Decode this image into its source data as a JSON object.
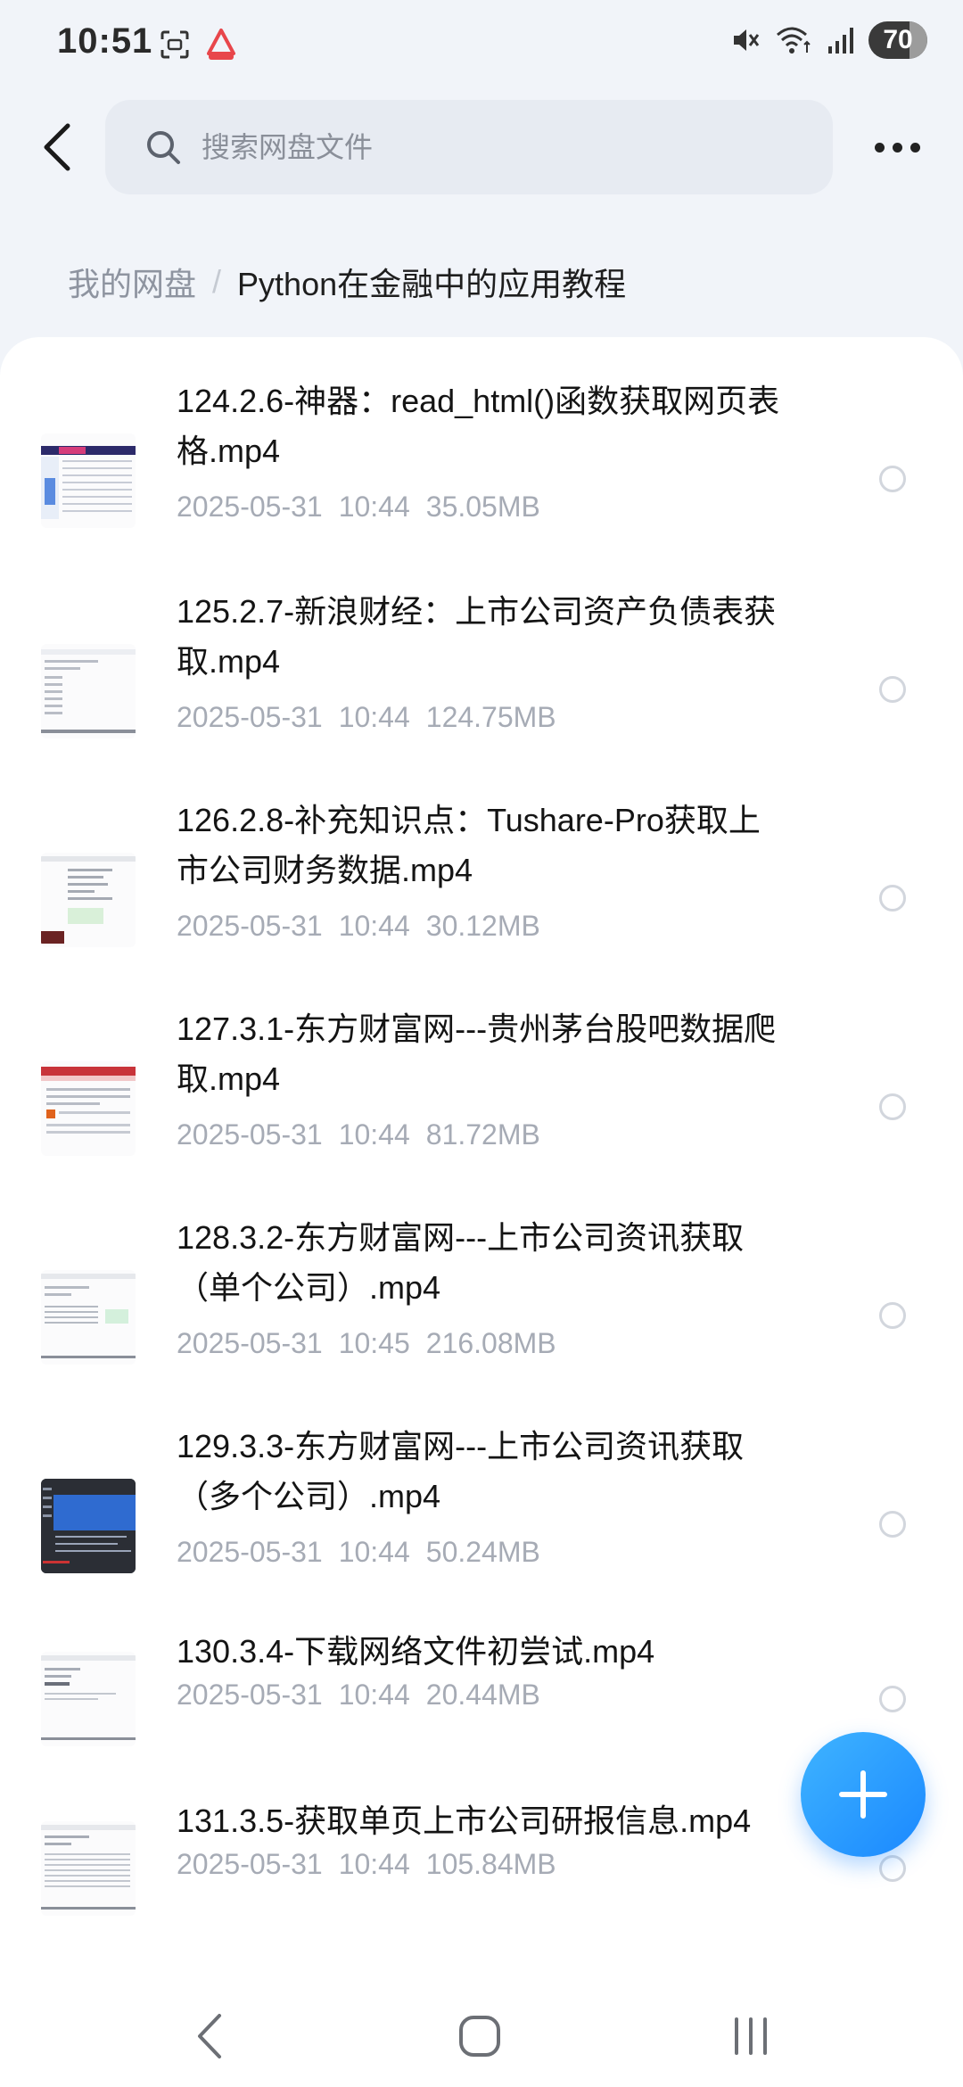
{
  "status_bar": {
    "time": "10:51",
    "battery": "70",
    "battery_level": 0.7,
    "icons": [
      "screenshot-icon",
      "app-badge-icon",
      "mute-icon",
      "wifi-icon",
      "signal-icon"
    ]
  },
  "header": {
    "search_placeholder": "搜索网盘文件",
    "back_icon": "back-arrow-icon",
    "more_icon": "more-icon"
  },
  "breadcrumb": {
    "root": "我的网盘",
    "separator": "/",
    "current": "Python在金融中的应用教程"
  },
  "files": [
    {
      "name_line1": "124.2.6-神器：read_html()函数获取网页表",
      "name_line2": "格.mp4",
      "date": "2025-05-31",
      "time": "10:44",
      "size": "35.05MB"
    },
    {
      "name_line1": "125.2.7-新浪财经：上市公司资产负债表获",
      "name_line2": "取.mp4",
      "date": "2025-05-31",
      "time": "10:44",
      "size": "124.75MB"
    },
    {
      "name_line1": "126.2.8-补充知识点：Tushare-Pro获取上",
      "name_line2": "市公司财务数据.mp4",
      "date": "2025-05-31",
      "time": "10:44",
      "size": "30.12MB"
    },
    {
      "name_line1": "127.3.1-东方财富网---贵州茅台股吧数据爬",
      "name_line2": "取.mp4",
      "date": "2025-05-31",
      "time": "10:44",
      "size": "81.72MB"
    },
    {
      "name_line1": "128.3.2-东方财富网---上市公司资讯获取",
      "name_line2": "（单个公司）.mp4",
      "date": "2025-05-31",
      "time": "10:45",
      "size": "216.08MB"
    },
    {
      "name_line1": "129.3.3-东方财富网---上市公司资讯获取",
      "name_line2": "（多个公司）.mp4",
      "date": "2025-05-31",
      "time": "10:44",
      "size": "50.24MB"
    },
    {
      "name_line1": "130.3.4-下载网络文件初尝试.mp4",
      "name_line2": "",
      "date": "2025-05-31",
      "time": "10:44",
      "size": "20.44MB"
    },
    {
      "name_line1": "131.3.5-获取单页上市公司研报信息.mp4",
      "name_line2": "",
      "date": "2025-05-31",
      "time": "10:44",
      "size": "105.84MB"
    }
  ],
  "fab": {
    "icon": "plus-icon",
    "color": "#2196ff"
  },
  "nav_bar": {
    "icons": [
      "nav-back-icon",
      "nav-home-icon",
      "nav-recents-icon"
    ]
  }
}
